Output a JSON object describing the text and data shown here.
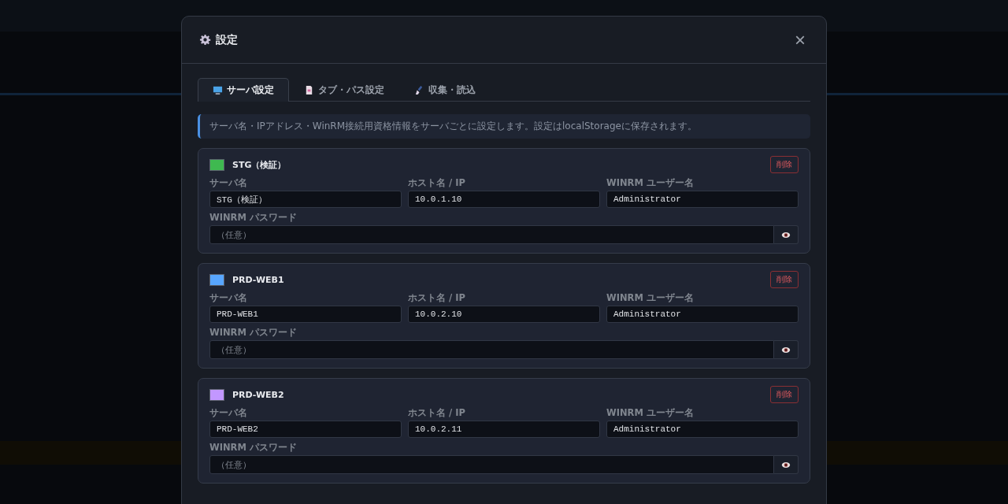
{
  "dialog": {
    "title": "設定",
    "close": "×"
  },
  "tabs": [
    {
      "label": "サーバ設定",
      "selected": true,
      "kind": "monitor"
    },
    {
      "label": "タブ・パス設定",
      "selected": false,
      "kind": "document"
    },
    {
      "label": "収集・読込",
      "selected": false,
      "kind": "brush"
    }
  ],
  "info": "サーバ名・IPアドレス・WinRM接続用資格情報をサーバごとに設定します。設定はlocalStorageに保存されます。",
  "servers": [
    {
      "title": "STG（検証）",
      "color": "#3fb950",
      "delete": "削除",
      "name_label": "サーバ名",
      "name": "STG（検証）",
      "host_label": "ホスト名 / IP",
      "host": "10.0.1.10",
      "user_label": "WINRM ユーザー名",
      "user": "Administrator",
      "password_label": "WINRM パスワード",
      "password_placeholder": "（任意）"
    },
    {
      "title": "PRD-WEB1",
      "color": "#58a6ff",
      "delete": "削除",
      "name_label": "サーバ名",
      "name": "PRD-WEB1",
      "host_label": "ホスト名 / IP",
      "host": "10.0.2.10",
      "user_label": "WINRM ユーザー名",
      "user": "Administrator",
      "password_label": "WINRM パスワード",
      "password_placeholder": "（任意）"
    },
    {
      "title": "PRD-WEB2",
      "color": "#c297ff",
      "delete": "削除",
      "name_label": "サーバ名",
      "name": "PRD-WEB2",
      "host_label": "ホスト名 / IP",
      "host": "10.0.2.11",
      "user_label": "WINRM ユーザー名",
      "user": "Administrator",
      "password_label": "WINRM パスワード",
      "password_placeholder": "（任意）"
    }
  ]
}
